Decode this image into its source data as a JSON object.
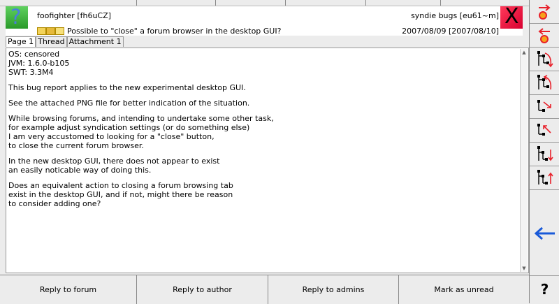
{
  "header": {
    "author": "foofighter [fh6uCZ]",
    "forum": "syndie bugs [eu61~m]",
    "subject": "Possible to \"close\" a forum browser in the desktop GUI?",
    "dates": "2007/08/09 [2007/08/10]",
    "close_glyph": "X",
    "avatar_glyph": "?"
  },
  "tabs": [
    {
      "label": "Page 1"
    },
    {
      "label": "Thread"
    },
    {
      "label": "Attachment 1"
    }
  ],
  "body": {
    "paragraphs": [
      "OS: censored\nJVM: 1.6.0-b105\nSWT: 3.3M4",
      "This bug report applies to the new experimental desktop GUI.",
      "See the attached PNG file for better indication of the situation.",
      "While browsing forums, and intending to undertake some other task,\nfor example adjust syndication settings (or do something else)\nI am very accustomed to looking for a \"close\" button,\nto close the current forum browser.",
      "In the new desktop GUI, there does not appear to exist\nan easily noticable way of doing this.",
      "Does an equivalent action to closing a forum browsing tab\nexist in the desktop GUI, and if not, might there be reason\nto consider adding one?"
    ]
  },
  "buttons": {
    "reply_forum": "Reply to forum",
    "reply_author": "Reply to author",
    "reply_admins": "Reply to admins",
    "mark_unread": "Mark as unread"
  },
  "sidebar": {
    "help_glyph": "?",
    "icons": [
      "next-thread-icon",
      "prev-thread-icon",
      "next-in-thread-icon",
      "prev-in-thread-icon",
      "next-message-icon",
      "prev-message-icon",
      "last-in-thread-icon",
      "first-in-thread-icon",
      "back-icon"
    ]
  },
  "colors": {
    "accent_red": "#e8202a",
    "arrow_blue": "#1a5ad8",
    "avatar_green": "#3cb83c",
    "close_red": "#ff2048"
  }
}
